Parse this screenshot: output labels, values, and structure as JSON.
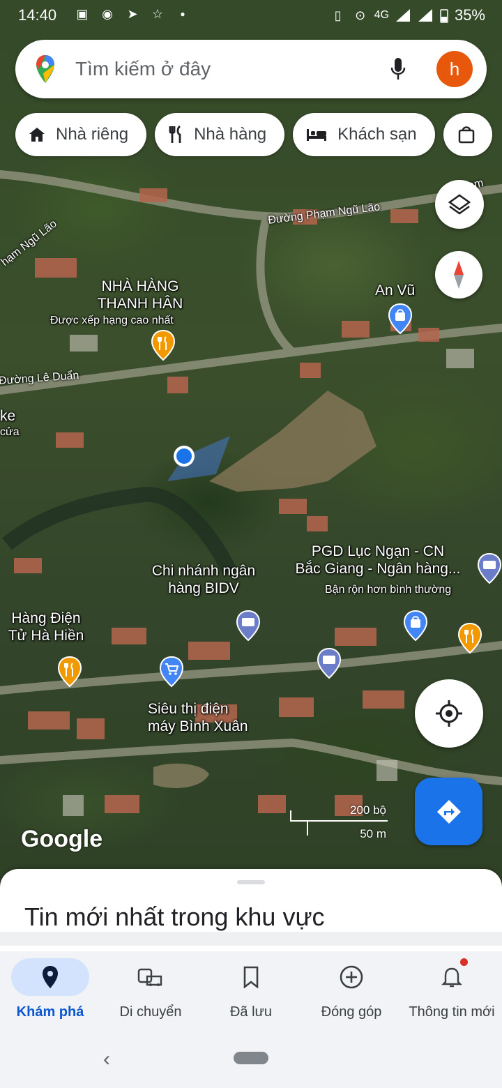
{
  "status_bar": {
    "time": "14:40",
    "network": "4G",
    "battery": "35%",
    "icons": [
      "gallery-icon",
      "messenger-icon",
      "telegram-icon",
      "star-app-icon",
      "dot-icon",
      "vibrate-icon",
      "location-icon",
      "signal-icon",
      "wifi-icon",
      "battery-icon"
    ]
  },
  "search": {
    "placeholder": "Tìm kiếm ở đây",
    "avatar_letter": "h",
    "avatar_color": "#e8580c"
  },
  "chips": [
    {
      "label": "Nhà riêng",
      "icon": "home-icon"
    },
    {
      "label": "Nhà hàng",
      "icon": "restaurant-icon"
    },
    {
      "label": "Khách sạn",
      "icon": "hotel-icon"
    },
    {
      "label": "",
      "icon": "shopping-bag-icon"
    }
  ],
  "map": {
    "streets": {
      "pham_ngu_lao_1": "Đường Phạm Ngũ Lão",
      "pham_ngu_lao_2": "hạm Ngũ Lão",
      "pham_ngu_lao_3": "Phạm",
      "le_duan": "Đường Lê Duẩn"
    },
    "places": {
      "thanh_han_1": "NHÀ HÀNG",
      "thanh_han_2": "THANH HÂN",
      "thanh_han_sub": "Được xếp hạng cao nhất",
      "an_vu": "An Vũ",
      "ke_1": "ke",
      "ke_2": "cửa",
      "bidv_1": "Chi nhánh ngân",
      "bidv_2": "hàng BIDV",
      "pgd_1": "PGD Lục Ngạn - CN",
      "pgd_2": "Bắc Giang - Ngân hàng...",
      "pgd_sub": "Bận rộn hơn bình thường",
      "hang_dien_1": "Hàng Điện",
      "hang_dien_2": "Tử Hà Hiền",
      "sieu_thi_1": "Siêu thị điện",
      "sieu_thi_2": "máy Bình Xuân"
    },
    "scale": {
      "imperial": "200 bộ",
      "metric": "50 m"
    },
    "attribution": "Google",
    "colors": {
      "restaurant_pin": "#f29900",
      "shopping_pin": "#4285f4",
      "bank_pin": "#6b7cc8",
      "location_dot": "#1a73e8"
    }
  },
  "sheet": {
    "title": "Tin mới nhất trong khu vực"
  },
  "nav": {
    "items": [
      {
        "label": "Khám phá",
        "icon": "explore-pin-icon",
        "active": true
      },
      {
        "label": "Di chuyển",
        "icon": "commute-icon",
        "active": false
      },
      {
        "label": "Đã lưu",
        "icon": "bookmark-icon",
        "active": false
      },
      {
        "label": "Đóng góp",
        "icon": "add-circle-icon",
        "active": false
      },
      {
        "label": "Thông tin mới",
        "icon": "bell-icon",
        "active": false
      }
    ]
  }
}
